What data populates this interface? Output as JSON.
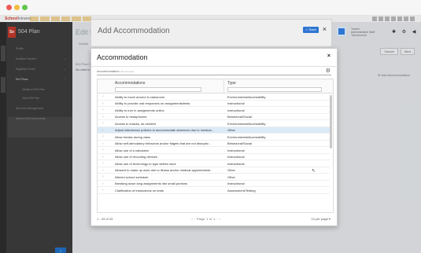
{
  "app": {
    "logo_main": "School",
    "logo_sub": "Intranet",
    "plan_badge": "Se",
    "plan_label": "504 Plan"
  },
  "sidebar": {
    "items": [
      {
        "label": "Profile",
        "top": 0
      },
      {
        "label": "Modified Student"
      },
      {
        "label": "Eligibility Forms"
      },
      {
        "label": "504 Plans"
      },
      {
        "label": "Details in 504 Plan"
      },
      {
        "label": "View 504 Plan"
      },
      {
        "label": "Services Management"
      },
      {
        "label": "Student 504 Documents"
      }
    ]
  },
  "main": {
    "title": "Edit 504",
    "sub_header": "Details",
    "section": "504 Plan D",
    "no_data": "No data to di",
    "cancel_label": "Cancel",
    "next_label": "Next",
    "add_label": "Add Accommodation"
  },
  "outer_modal": {
    "title": "Add Accommodation",
    "save_label": "Save",
    "close_glyph": "×"
  },
  "user": {
    "name": "Trainer",
    "line2": "Administrative Staff",
    "line3": "Test Account",
    "icons": "✱ ⚙ ◀"
  },
  "modal": {
    "title": "Accommodation",
    "close_glyph": "×",
    "field_label": "Accommodation",
    "field_hint": "(63 selected)",
    "gear_glyph": "⚙"
  },
  "grid": {
    "col_accommodations": "Accommodations",
    "col_type": "Type",
    "filter_placeholder": "",
    "rows": [
      {
        "name": "Ability to move around in classroom",
        "type": "Environmental/Accessibility",
        "selected": false
      },
      {
        "name": "Ability to provide oral responses on assignments/tests",
        "type": "Instructional",
        "selected": false
      },
      {
        "name": "Ability to turn in assignments online",
        "type": "Instructional",
        "selected": false
      },
      {
        "name": "Access to headphones",
        "type": "Behavioral/Social",
        "selected": false
      },
      {
        "name": "Access to snacks, as needed",
        "type": "Environmental/Accessibility",
        "selected": false
      },
      {
        "name": "Adjust attendance policies to accommodate absences due to medical...",
        "type": "Other",
        "selected": true
      },
      {
        "name": "Allow breaks during class",
        "type": "Environmental/Accessibility",
        "selected": false
      },
      {
        "name": "Allow self-stimulatory behaviors and/or fidgets that are not disruptiv...",
        "type": "Behavioral/Social",
        "selected": false
      },
      {
        "name": "Allow use of a calculator",
        "type": "Instructional",
        "selected": false
      },
      {
        "name": "Allow use of recording devices",
        "type": "Instructional",
        "selected": false
      },
      {
        "name": "Allow use of technology to type written work",
        "type": "Instructional",
        "selected": false
      },
      {
        "name": "Allowed to make up work due to illness and/or medical appointments",
        "type": "Other",
        "selected": false
      },
      {
        "name": "Altered school schedule",
        "type": "Other",
        "selected": false
      },
      {
        "name": "Breaking down long assignments into small portions",
        "type": "Instructional",
        "selected": false
      },
      {
        "name": "Clarification of instructions on tests",
        "type": "Assessment/Testing",
        "selected": false
      }
    ],
    "footer_count": "1 - 43 of 43",
    "pager": "Page 1 of 1",
    "per_page": "10 per page"
  }
}
